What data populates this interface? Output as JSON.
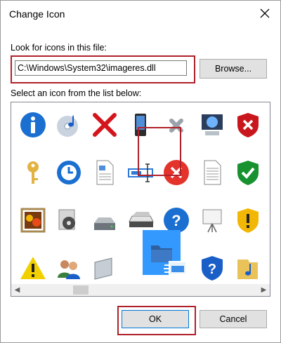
{
  "window": {
    "title": "Change Icon"
  },
  "file": {
    "label": "Look for icons in this file:",
    "path_value": "C:\\Windows\\System32\\imageres.dll",
    "browse_label": "Browse..."
  },
  "list": {
    "label": "Select an icon from the list below:",
    "selected_index": 27
  },
  "buttons": {
    "ok_label": "OK",
    "cancel_label": "Cancel"
  },
  "icons": [
    {
      "name": "info-icon"
    },
    {
      "name": "cd-music-icon"
    },
    {
      "name": "red-x-icon"
    },
    {
      "name": "pda-device-icon"
    },
    {
      "name": "gray-x-icon"
    },
    {
      "name": "monitor-globe-icon"
    },
    {
      "name": "shield-error-icon"
    },
    {
      "name": "speaker-partial-icon"
    },
    {
      "name": "key-icon"
    },
    {
      "name": "clock-network-icon"
    },
    {
      "name": "document-image-icon"
    },
    {
      "name": "text-field-icon"
    },
    {
      "name": "error-circle-icon"
    },
    {
      "name": "text-document-icon"
    },
    {
      "name": "shield-check-icon"
    },
    {
      "name": "partial-blue-icon"
    },
    {
      "name": "photo-flowers-icon"
    },
    {
      "name": "media-library-icon"
    },
    {
      "name": "drive-icon"
    },
    {
      "name": "scanner-icon"
    },
    {
      "name": "help-circle-icon"
    },
    {
      "name": "projector-screen-icon"
    },
    {
      "name": "shield-warning-icon"
    },
    {
      "name": "partial-red-icon"
    },
    {
      "name": "warning-icon"
    },
    {
      "name": "users-icon"
    },
    {
      "name": "panel-icon"
    },
    {
      "name": "folder-blue-icon"
    },
    {
      "name": "window-fast-icon"
    },
    {
      "name": "shield-help-icon"
    },
    {
      "name": "music-folder-icon"
    },
    {
      "name": "partial-yellow-icon"
    }
  ],
  "colors": {
    "highlight": "#b0202a",
    "selection": "#3399ff"
  }
}
